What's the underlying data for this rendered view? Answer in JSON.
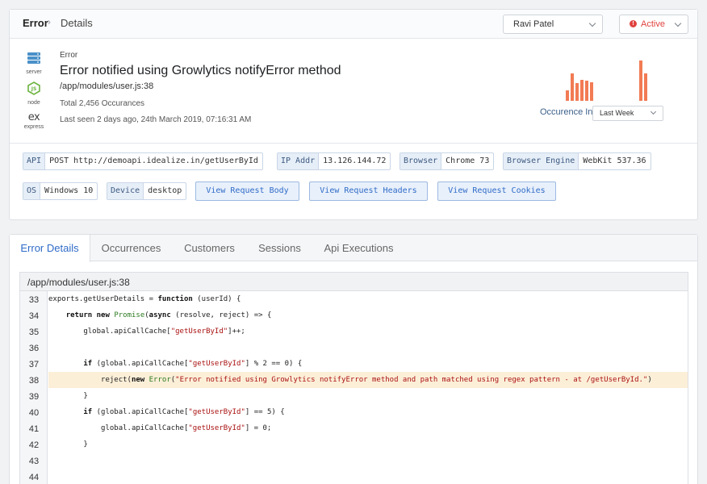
{
  "breadcrumb": {
    "root": "Error",
    "separator": "›",
    "current": "Details"
  },
  "user_select": {
    "value": "Ravi Patel"
  },
  "status_select": {
    "value": "Active"
  },
  "stack": [
    {
      "icon": "server-icon",
      "label": "server"
    },
    {
      "icon": "nodejs-icon",
      "label": "node"
    },
    {
      "icon": "express-icon",
      "label": "express",
      "logo": "ex"
    }
  ],
  "error": {
    "kind": "Error",
    "title": "Error notified using Growlytics notifyError method",
    "path": "/app/modules/user.js:38",
    "total": "Total 2,456 Occurances",
    "last_seen": "Last seen 2 days ago, 24th March 2019, 07:16:31 AM"
  },
  "occurrence": {
    "label": "Occurence In",
    "range": "Last Week",
    "bar_color": "#f27b54",
    "bars": [
      0.22,
      0.6,
      0.38,
      0.46,
      0.44,
      0.4,
      0.88,
      0.6
    ]
  },
  "tags": [
    {
      "key": "API",
      "value": "POST  http://demoapi.idealize.in/getUserById"
    },
    {
      "key": "IP Addr",
      "value": "13.126.144.72"
    },
    {
      "key": "Browser",
      "value": "Chrome 73"
    },
    {
      "key": "Browser Engine",
      "value": "WebKit 537.36"
    },
    {
      "key": "OS",
      "value": "Windows 10"
    },
    {
      "key": "Device",
      "value": "desktop"
    }
  ],
  "request_buttons": {
    "body": "View Request Body",
    "headers": "View Request Headers",
    "cookies": "View Request Cookies"
  },
  "tabs": [
    "Error Details",
    "Occurrences",
    "Customers",
    "Sessions",
    "Api Executions"
  ],
  "active_tab": "Error Details",
  "code": {
    "file": "/app/modules/user.js:38",
    "highlight_line": 38,
    "lines": [
      {
        "n": "33",
        "text": "exports.getUserDetails = function (userId) {"
      },
      {
        "n": "34",
        "text": "    return new Promise(async (resolve, reject) => {"
      },
      {
        "n": "35",
        "text": "        global.apiCallCache[\"getUserById\"]++;"
      },
      {
        "n": "36",
        "text": ""
      },
      {
        "n": "37",
        "text": "        if (global.apiCallCache[\"getUserById\"] % 2 == 0) {"
      },
      {
        "n": "38",
        "text": "            reject(new Error(\"Error notified using Growlytics notifyError method and path matched using regex pattern - at /getUserById.\")"
      },
      {
        "n": "39",
        "text": "        }"
      },
      {
        "n": "40",
        "text": "        if (global.apiCallCache[\"getUserById\"] == 5) {"
      },
      {
        "n": "41",
        "text": "            global.apiCallCache[\"getUserById\"] = 0;"
      },
      {
        "n": "42",
        "text": "        }"
      },
      {
        "n": "43",
        "text": ""
      },
      {
        "n": "44",
        "text": ""
      }
    ]
  }
}
